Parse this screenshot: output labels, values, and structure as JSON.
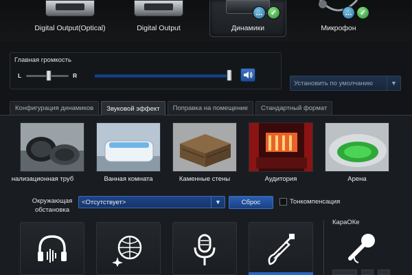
{
  "devices": [
    {
      "label": "Digital Output(Optical)"
    },
    {
      "label": "Digital Output"
    },
    {
      "label": "Динамики",
      "selected": true
    },
    {
      "label": "Микрофон"
    }
  ],
  "volume": {
    "title": "Главная громкость",
    "balance_left": "L",
    "balance_right": "R",
    "level_percent": 100
  },
  "default_dropdown": "Установить по умолчанию",
  "tabs": [
    {
      "label": "Конфигурация динамиков"
    },
    {
      "label": "Звуковой эффект",
      "active": true
    },
    {
      "label": "Поправка на помещение"
    },
    {
      "label": "Стандартный формат"
    }
  ],
  "environments": [
    {
      "label": "Канализационная труба",
      "shown": "нализационная труб"
    },
    {
      "label": "Ванная комната"
    },
    {
      "label": "Каменные стены"
    },
    {
      "label": "Аудитория"
    },
    {
      "label": "Арена"
    }
  ],
  "surround": {
    "label_line1": "Окружающая",
    "label_line2": "обстановка",
    "selected": "<Отсутствует>",
    "reset_label": "Сброс",
    "loudness_label": "Тонкомпенсация",
    "loudness_checked": false
  },
  "effects": [
    {
      "icon": "headphones-icon"
    },
    {
      "icon": "disco-ball-icon"
    },
    {
      "icon": "microphone-icon"
    },
    {
      "icon": "guitar-icon",
      "active": true
    }
  ],
  "karaoke": {
    "title": "КараОКе"
  },
  "colors": {
    "accent": "#2a66c6",
    "background": "#121417",
    "ok_badge": "#2d8c34",
    "chat_badge": "#2a6f98"
  }
}
